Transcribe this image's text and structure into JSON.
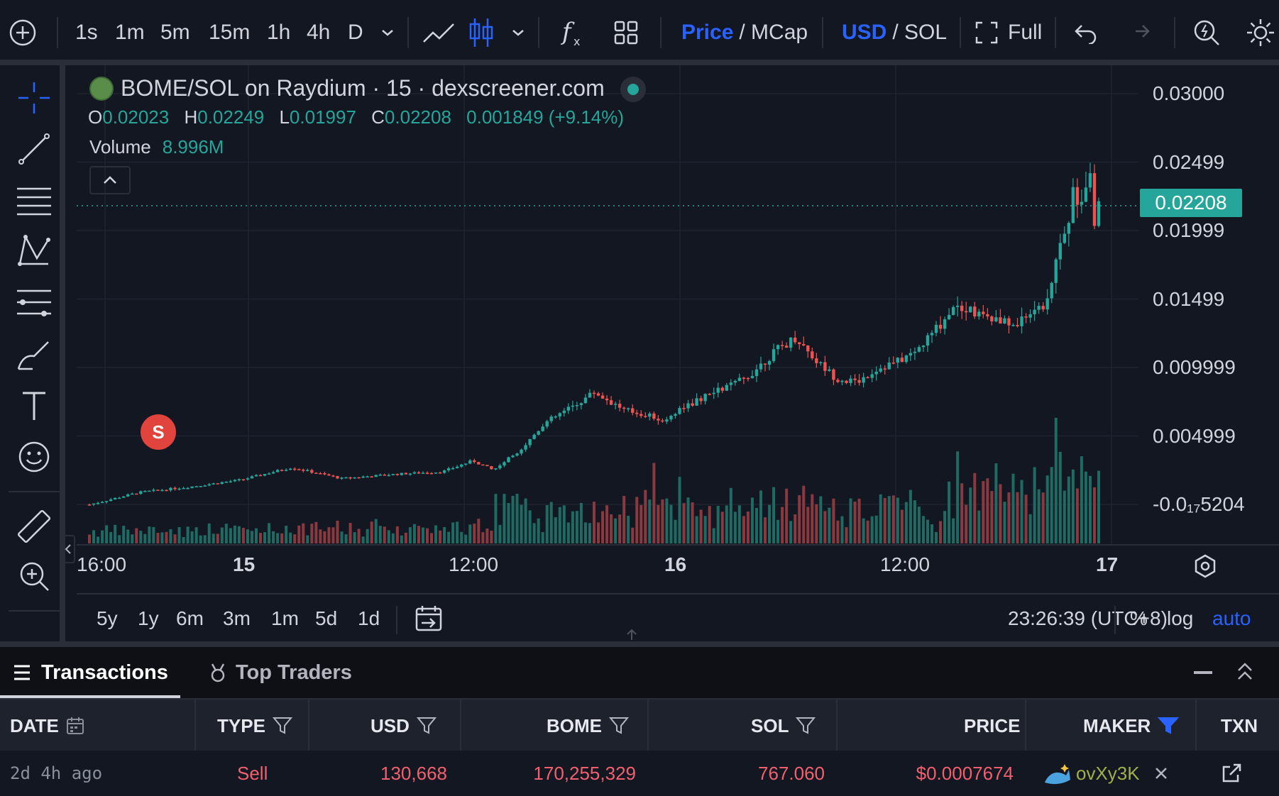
{
  "toolbar": {
    "timeframes": [
      "1s",
      "1m",
      "5m",
      "15m",
      "1h",
      "4h",
      "D"
    ],
    "active_timeframe": "15m",
    "price_label": "Price",
    "mcap_label": "/ MCap",
    "usd_label": "USD",
    "sol_label": "/ SOL",
    "full_label": "Full"
  },
  "legend": {
    "title": "BOME/SOL on Raydium · 15 · dexscreener.com",
    "open_key": "O",
    "open": "0.02023",
    "high_key": "H",
    "high": "0.02249",
    "low_key": "L",
    "low": "0.01997",
    "close_key": "C",
    "close": "0.02208",
    "change": "0.001849 (+9.14%)",
    "volume_key": "Volume",
    "volume": "8.996M"
  },
  "price_tag": "0.02208",
  "marker": "S",
  "chart_data": {
    "type": "candlestick",
    "y_ticks": [
      "0.03000",
      "0.02499",
      "0.01999",
      "0.01499",
      "0.009999",
      "0.004999",
      "-0.0₁₇5204"
    ],
    "x_ticks": [
      "16:00",
      "15",
      "12:00",
      "16",
      "12:00",
      "17"
    ],
    "ylim": [
      0,
      0.03
    ],
    "last_price": 0.02208,
    "ohlc": {
      "open": 0.02023,
      "high": 0.02249,
      "low": 0.01997,
      "close": 0.02208
    },
    "trend_points": [
      [
        0,
        0.0003
      ],
      [
        0.05,
        0.0012
      ],
      [
        0.1,
        0.0016
      ],
      [
        0.15,
        0.0021
      ],
      [
        0.2,
        0.003
      ],
      [
        0.25,
        0.0022
      ],
      [
        0.3,
        0.0025
      ],
      [
        0.35,
        0.0027
      ],
      [
        0.38,
        0.0035
      ],
      [
        0.4,
        0.0028
      ],
      [
        0.43,
        0.0045
      ],
      [
        0.45,
        0.0062
      ],
      [
        0.48,
        0.0075
      ],
      [
        0.5,
        0.0085
      ],
      [
        0.53,
        0.0072
      ],
      [
        0.57,
        0.0065
      ],
      [
        0.6,
        0.0078
      ],
      [
        0.62,
        0.0085
      ],
      [
        0.65,
        0.0095
      ],
      [
        0.68,
        0.0115
      ],
      [
        0.7,
        0.0125
      ],
      [
        0.72,
        0.0108
      ],
      [
        0.74,
        0.0095
      ],
      [
        0.76,
        0.0092
      ],
      [
        0.78,
        0.0102
      ],
      [
        0.8,
        0.0107
      ],
      [
        0.82,
        0.0115
      ],
      [
        0.84,
        0.0132
      ],
      [
        0.86,
        0.015
      ],
      [
        0.88,
        0.0142
      ],
      [
        0.9,
        0.0136
      ],
      [
        0.92,
        0.0135
      ],
      [
        0.94,
        0.0148
      ],
      [
        0.95,
        0.0149
      ],
      [
        0.96,
        0.0195
      ],
      [
        0.97,
        0.021
      ],
      [
        0.975,
        0.0235
      ],
      [
        0.98,
        0.0215
      ],
      [
        0.985,
        0.0225
      ],
      [
        0.99,
        0.026
      ],
      [
        0.993,
        0.024
      ],
      [
        0.996,
        0.021
      ],
      [
        1.0,
        0.0221
      ]
    ]
  },
  "ranges": [
    "5y",
    "1y",
    "6m",
    "3m",
    "1m",
    "5d",
    "1d"
  ],
  "clock": "23:26:39 (UTC+8)",
  "scale_options": {
    "percent": "%",
    "log": "log",
    "auto": "auto"
  },
  "tabs": {
    "transactions": "Transactions",
    "top_traders": "Top Traders"
  },
  "table": {
    "headers": {
      "date": "DATE",
      "type": "TYPE",
      "usd": "USD",
      "bome": "BOME",
      "sol": "SOL",
      "price": "PRICE",
      "maker": "MAKER",
      "txn": "TXN"
    },
    "row": {
      "date": "2d 4h ago",
      "type": "Sell",
      "usd": "130,668",
      "bome": "170,255,329",
      "sol": "767.060",
      "price": "$0.0007674",
      "maker": "ovXy3K"
    }
  }
}
